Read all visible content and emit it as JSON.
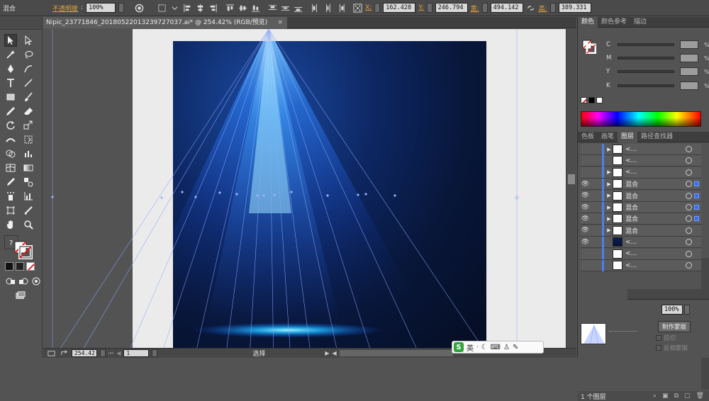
{
  "control_bar": {
    "object_type": "混合",
    "opacity_label": "不透明度",
    "opacity_value": "100%",
    "x_label": "X:",
    "x_value": "162.428",
    "y_label": "Y:",
    "y_value": "246.794",
    "width_label": "宽:",
    "width_value": "494.142",
    "height_label": "高:",
    "height_value": "389.331"
  },
  "document": {
    "tab_title": "Nipic_23771846_20180522013239727037.ai* @ 254.42% (RGB/预览)",
    "close_label": "×"
  },
  "status_bar": {
    "zoom": "254.42",
    "page": "1",
    "status_text": "选择"
  },
  "ime": {
    "logo": "S",
    "lang": "英"
  },
  "color_panel": {
    "tabs": [
      "颜色",
      "颜色参考",
      "描边"
    ],
    "rows": [
      {
        "label": "C",
        "unit": "%"
      },
      {
        "label": "M",
        "unit": "%"
      },
      {
        "label": "Y",
        "unit": "%"
      },
      {
        "label": "K",
        "unit": "%"
      }
    ]
  },
  "layers_panel": {
    "tabs": [
      "色板",
      "画笔",
      "图层",
      "路径查找器"
    ],
    "rows": [
      {
        "name": "<...",
        "visible": false,
        "expand": true,
        "thumb": "light",
        "selected": false
      },
      {
        "name": "<...",
        "visible": false,
        "expand": false,
        "thumb": "light",
        "selected": false
      },
      {
        "name": "<...",
        "visible": false,
        "expand": true,
        "thumb": "light",
        "selected": false
      },
      {
        "name": "混合",
        "visible": true,
        "expand": true,
        "thumb": "light",
        "selected": true
      },
      {
        "name": "混合",
        "visible": true,
        "expand": true,
        "thumb": "light",
        "selected": true
      },
      {
        "name": "混合",
        "visible": true,
        "expand": true,
        "thumb": "light",
        "selected": true
      },
      {
        "name": "混合",
        "visible": true,
        "expand": true,
        "thumb": "light",
        "selected": true
      },
      {
        "name": "混合",
        "visible": true,
        "expand": true,
        "thumb": "light",
        "selected": false
      },
      {
        "name": "<...",
        "visible": true,
        "expand": false,
        "thumb": "dark",
        "selected": false
      },
      {
        "name": "<...",
        "visible": false,
        "expand": false,
        "thumb": "light",
        "selected": false
      },
      {
        "name": "<...",
        "visible": false,
        "expand": false,
        "thumb": "light",
        "selected": false
      }
    ],
    "footer": "1 个图层"
  },
  "transparency_panel": {
    "opacity_value": "100%",
    "make_mask_button": "制作蒙版",
    "clip_label": "剪切",
    "invert_mask_label": "反相蒙版"
  }
}
